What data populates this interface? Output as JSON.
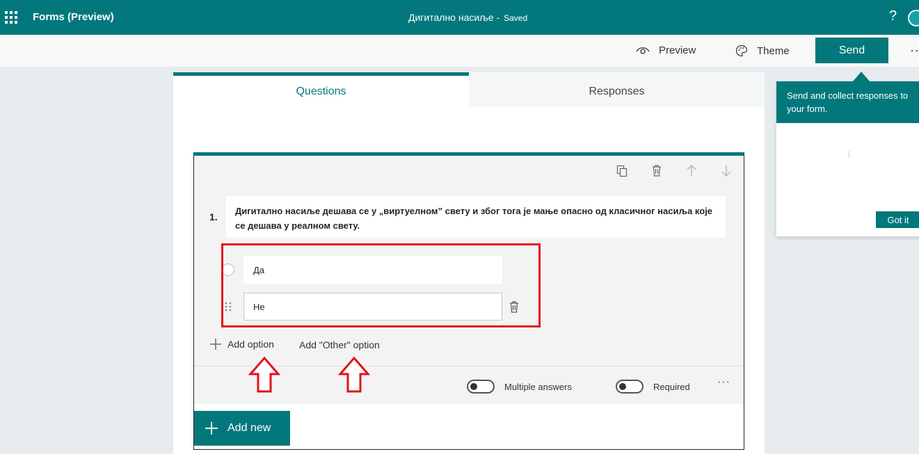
{
  "header": {
    "app_title": "Forms (Preview)",
    "form_title": "Дигитално насиље",
    "separator": "-",
    "save_state": "Saved",
    "help": "?"
  },
  "commandbar": {
    "preview": "Preview",
    "theme": "Theme",
    "send": "Send",
    "more": "···"
  },
  "tabs": [
    {
      "label": "Questions",
      "active": true
    },
    {
      "label": "Responses",
      "active": false
    }
  ],
  "question": {
    "number": "1.",
    "text": "Дигитално насиље дешава се у „виртуелном” свету и због тога је мање опасно од класичног насиља које се дешава у реалном свету.",
    "options": [
      {
        "value": "Да"
      },
      {
        "value": "Не"
      }
    ],
    "add_option": "Add option",
    "add_other": "Add \"Other\" option",
    "multiple_answers": "Multiple answers",
    "required": "Required",
    "more": "···"
  },
  "add_new": "Add new",
  "bubble": {
    "text": "Send and collect responses to your form.",
    "got_it": "Got it"
  },
  "colors": {
    "brand": "#03787c",
    "highlight": "#e3101a"
  }
}
